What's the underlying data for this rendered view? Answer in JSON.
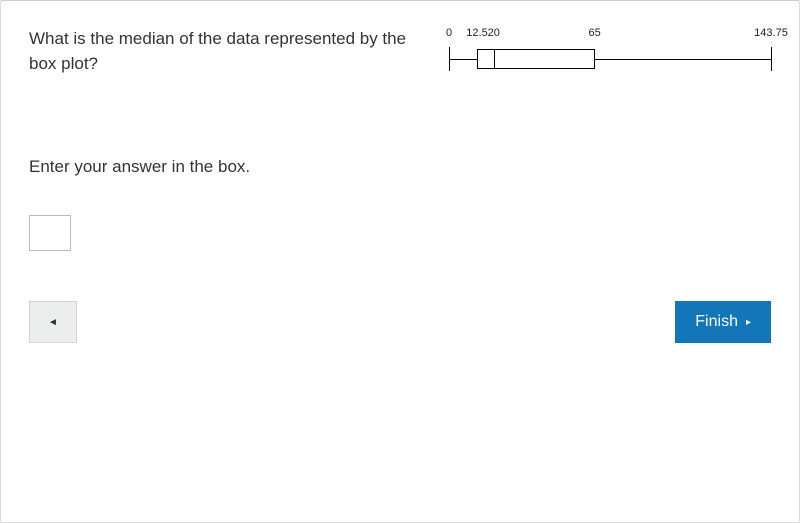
{
  "question": {
    "prompt": "What is the median of the data represented by the box plot?",
    "instruction": "Enter your answer in the box."
  },
  "answer": {
    "value": "",
    "placeholder": ""
  },
  "nav": {
    "back_glyph": "◄",
    "finish_label": "Finish",
    "finish_glyph": "▸"
  },
  "chart_data": {
    "type": "boxplot",
    "min": 0,
    "q1": 12.5,
    "median": 20,
    "q3": 65,
    "max": 143.75,
    "labels": {
      "min": "0",
      "q1": "12.5",
      "median": "20",
      "q3": "65",
      "max": "143.75"
    },
    "range": [
      0,
      143.75
    ]
  }
}
